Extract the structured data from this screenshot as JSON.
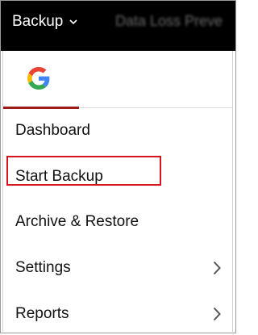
{
  "topbar": {
    "menu_title": "Backup",
    "next_tab": "Data Loss Preve"
  },
  "provider_tab": {
    "icon": "google-icon"
  },
  "menu": {
    "items": [
      {
        "label": "Dashboard",
        "has_submenu": false
      },
      {
        "label": "Start Backup",
        "has_submenu": false
      },
      {
        "label": "Archive & Restore",
        "has_submenu": false,
        "highlighted": true
      },
      {
        "label": "Settings",
        "has_submenu": true
      },
      {
        "label": "Reports",
        "has_submenu": true
      }
    ]
  },
  "colors": {
    "topbar": "#000000",
    "active_tab_underline": "#a01a1a",
    "highlight_border": "#d7141d"
  }
}
